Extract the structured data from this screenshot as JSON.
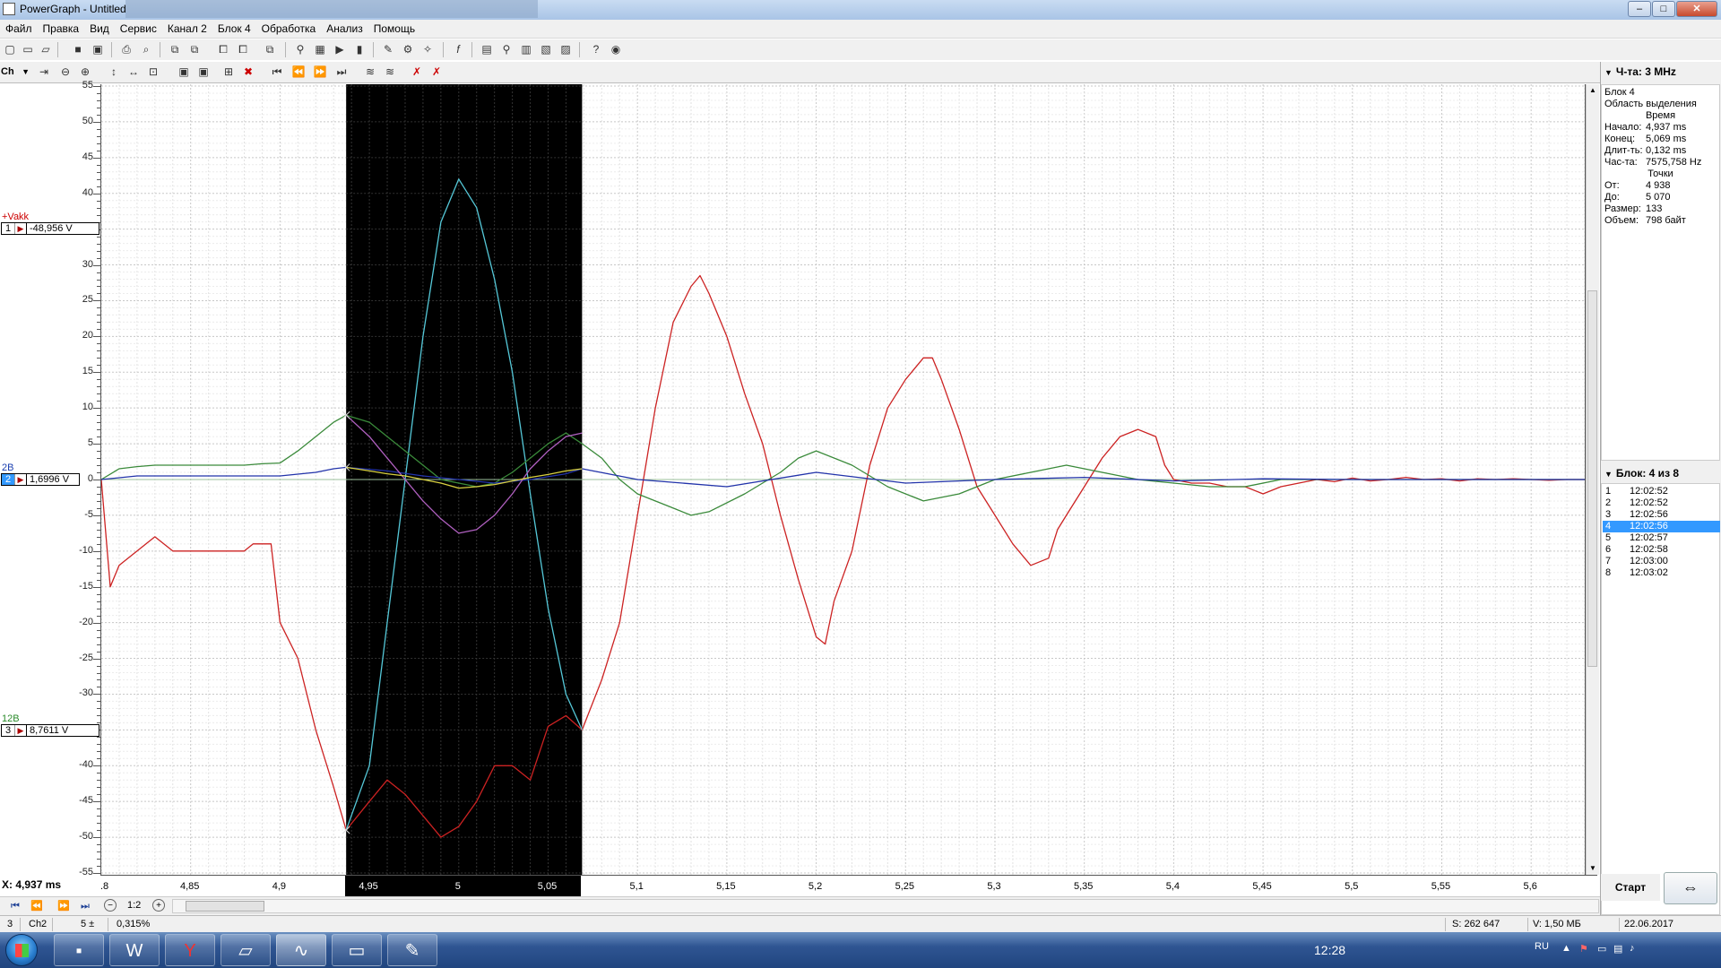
{
  "window": {
    "title": "PowerGraph - Untitled",
    "minimize": "–",
    "maximize": "□",
    "close": "✕"
  },
  "menu": [
    "Файл",
    "Правка",
    "Вид",
    "Сервис",
    "Канал 2",
    "Блок 4",
    "Обработка",
    "Анализ",
    "Помощь"
  ],
  "toolbar2": {
    "channel_select": "Ch"
  },
  "y_axis": {
    "ticks": [
      "55",
      "50",
      "45",
      "40",
      "35",
      "30",
      "25",
      "20",
      "15",
      "10",
      "5",
      "0",
      "-5",
      "-10",
      "-15",
      "-20",
      "-25",
      "-30",
      "-35",
      "-40",
      "-45",
      "-50",
      "-55"
    ]
  },
  "channels": [
    {
      "tag": "+Vakk",
      "num": "1",
      "value": "-48,956 V",
      "tag_color": "#cc0000",
      "selected": false
    },
    {
      "tag": "2B",
      "num": "2",
      "value": "1,6996 V",
      "tag_color": "#1a3fb0",
      "selected": true
    },
    {
      "tag": "12B",
      "num": "3",
      "value": "8,7611 V",
      "tag_color": "#2a8a2a",
      "selected": false
    }
  ],
  "x_axis": {
    "readout": "X: 4,937 ms",
    "ticks": [
      ".8",
      "4,85",
      "4,9",
      "4,95",
      "5",
      "5,05",
      "5,1",
      "5,15",
      "5,2",
      "5,25",
      "5,3",
      "5,35",
      "5,4",
      "5,45",
      "5,5",
      "5,55",
      "5,6"
    ]
  },
  "nav": {
    "zoom_label": "1:2",
    "first": "⏮",
    "prev": "⏪",
    "next": "⏩",
    "last": "⏭",
    "zoom_out": "−",
    "zoom_in": "+"
  },
  "status": {
    "num": "3",
    "channel": "Ch2",
    "value": "5 ±",
    "percent": "0,315%",
    "samples": "S: 262 647",
    "volume": "V: 1,50 МБ",
    "date": "22.06.2017"
  },
  "right_panel": {
    "freq": "Ч-та: 3 MHz",
    "block_title": "Блок 4",
    "selection_title": "Область выделения",
    "time_title": "Время",
    "time_rows": [
      {
        "k": "Начало:",
        "v": "4,937 ms"
      },
      {
        "k": "Конец:",
        "v": "5,069 ms"
      },
      {
        "k": "Длит-ть:",
        "v": "0,132 ms"
      },
      {
        "k": "Час-та:",
        "v": "7575,758 Hz"
      }
    ],
    "points_title": "Точки",
    "point_rows": [
      {
        "k": "От:",
        "v": "4 938"
      },
      {
        "k": "До:",
        "v": "5 070"
      },
      {
        "k": "Размер:",
        "v": "133"
      },
      {
        "k": "Объем:",
        "v": "798 байт"
      }
    ],
    "block_header": "Блок: 4 из 8",
    "blocks": [
      {
        "n": "1",
        "t": "12:02:52",
        "sel": false
      },
      {
        "n": "2",
        "t": "12:02:52",
        "sel": false
      },
      {
        "n": "3",
        "t": "12:02:56",
        "sel": false
      },
      {
        "n": "4",
        "t": "12:02:56",
        "sel": true
      },
      {
        "n": "5",
        "t": "12:02:57",
        "sel": false
      },
      {
        "n": "6",
        "t": "12:02:58",
        "sel": false
      },
      {
        "n": "7",
        "t": "12:03:00",
        "sel": false
      },
      {
        "n": "8",
        "t": "12:03:02",
        "sel": false
      }
    ],
    "start_label": "Старт"
  },
  "taskbar": {
    "lang": "RU",
    "time": "12:28"
  },
  "colors": {
    "red": "#cc2222",
    "cyan": "#55c8d8",
    "green": "#3a8a3a",
    "blue": "#2233aa",
    "magenta": "#b060c0",
    "yellow": "#d8d040",
    "selection": "#000000"
  },
  "chart_data": {
    "type": "line",
    "xlim": [
      4.8,
      5.63
    ],
    "ylim": [
      -55,
      55
    ],
    "selection": [
      4.937,
      5.069
    ],
    "series": [
      {
        "color": "#cc2222",
        "x": [
          4.8,
          4.805,
          4.81,
          4.815,
          4.82,
          4.83,
          4.84,
          4.845,
          4.85,
          4.86,
          4.87,
          4.88,
          4.885,
          4.89,
          4.895,
          4.9,
          4.91,
          4.92,
          4.93,
          4.937,
          4.95,
          4.96,
          4.97,
          4.98,
          4.99,
          5.0,
          5.01,
          5.02,
          5.03,
          5.04,
          5.05,
          5.06,
          5.069,
          5.08,
          5.09,
          5.1,
          5.11,
          5.12,
          5.13,
          5.135,
          5.14,
          5.15,
          5.16,
          5.17,
          5.18,
          5.19,
          5.2,
          5.205,
          5.21,
          5.22,
          5.23,
          5.24,
          5.25,
          5.26,
          5.265,
          5.27,
          5.28,
          5.29,
          5.3,
          5.31,
          5.32,
          5.33,
          5.335,
          5.34,
          5.35,
          5.36,
          5.37,
          5.38,
          5.39,
          5.395,
          5.4,
          5.41,
          5.42,
          5.43,
          5.44,
          5.45,
          5.455,
          5.46,
          5.47,
          5.48,
          5.49,
          5.5,
          5.51,
          5.52,
          5.53,
          5.54,
          5.55,
          5.56,
          5.57,
          5.58,
          5.59,
          5.6,
          5.61,
          5.62,
          5.63
        ],
        "y": [
          0,
          -15,
          -12,
          -11,
          -10,
          -8,
          -10,
          -10,
          -10,
          -10,
          -10,
          -10,
          -9,
          -9,
          -9,
          -20,
          -25,
          -35,
          -43,
          -49,
          -45,
          -42,
          -44,
          -47,
          -50,
          -48.5,
          -45,
          -40,
          -40,
          -42,
          -34.5,
          -33,
          -35,
          -28,
          -20,
          -5,
          10,
          22,
          27,
          28.5,
          26,
          20,
          12,
          5,
          -5,
          -14,
          -22,
          -23,
          -17,
          -10,
          2,
          10,
          14,
          17,
          17,
          14,
          7,
          -1,
          -5,
          -9,
          -12,
          -11,
          -7,
          -5,
          -1,
          3,
          6,
          7,
          6,
          2,
          0,
          -0.5,
          -0.5,
          -1,
          -1,
          -2,
          -1.5,
          -1,
          -0.5,
          0,
          -0.3,
          0.2,
          -0.2,
          0,
          0.3,
          0,
          0.1,
          -0.2,
          0.1,
          0,
          0.1,
          0,
          -0.1,
          0,
          0
        ]
      },
      {
        "color": "#55c8d8",
        "x": [
          4.937,
          4.95,
          4.96,
          4.97,
          4.98,
          4.99,
          5.0,
          5.01,
          5.02,
          5.03,
          5.04,
          5.05,
          5.06,
          5.069
        ],
        "y": [
          -49,
          -40,
          -20,
          0,
          20,
          36,
          42,
          38,
          28,
          15,
          -2,
          -18,
          -30,
          -35
        ]
      },
      {
        "color": "#3a8a3a",
        "x": [
          4.8,
          4.81,
          4.82,
          4.83,
          4.84,
          4.85,
          4.86,
          4.87,
          4.88,
          4.89,
          4.9,
          4.91,
          4.92,
          4.93,
          4.937,
          4.95,
          4.96,
          4.97,
          4.98,
          4.99,
          5.0,
          5.01,
          5.02,
          5.03,
          5.04,
          5.05,
          5.06,
          5.069,
          5.08,
          5.09,
          5.1,
          5.12,
          5.13,
          5.14,
          5.16,
          5.18,
          5.19,
          5.2,
          5.22,
          5.24,
          5.26,
          5.28,
          5.3,
          5.32,
          5.34,
          5.36,
          5.38,
          5.4,
          5.42,
          5.44,
          5.46,
          5.5,
          5.55,
          5.6,
          5.63
        ],
        "y": [
          0,
          1.5,
          1.8,
          2,
          2,
          2,
          2,
          2,
          2,
          2.2,
          2.3,
          4,
          6,
          8,
          9,
          8,
          6,
          4,
          2,
          0,
          -0.5,
          -1,
          -0.5,
          1,
          3,
          5,
          6.5,
          5,
          3,
          0,
          -2,
          -4,
          -5,
          -4.5,
          -2,
          1,
          3,
          4,
          2,
          -1,
          -3,
          -2,
          0,
          1,
          2,
          1,
          0,
          -0.5,
          -1,
          -1,
          0,
          0,
          0,
          0,
          0
        ]
      },
      {
        "color": "#2233aa",
        "x": [
          4.8,
          4.82,
          4.84,
          4.86,
          4.88,
          4.9,
          4.92,
          4.93,
          4.937,
          4.96,
          4.98,
          5.0,
          5.02,
          5.04,
          5.06,
          5.069,
          5.1,
          5.15,
          5.2,
          5.25,
          5.3,
          5.35,
          5.4,
          5.45,
          5.5,
          5.55,
          5.6,
          5.63
        ],
        "y": [
          0,
          0.5,
          0.5,
          0.5,
          0.5,
          0.5,
          1,
          1.5,
          1.7,
          1.2,
          0.5,
          0,
          -0.5,
          0,
          0.8,
          1.5,
          0,
          -1,
          1,
          -0.5,
          0,
          0.3,
          -0.2,
          0.1,
          0,
          0,
          0,
          0
        ]
      },
      {
        "color": "#b060c0",
        "x": [
          4.937,
          4.95,
          4.96,
          4.97,
          4.98,
          4.99,
          5.0,
          5.01,
          5.02,
          5.03,
          5.04,
          5.05,
          5.06,
          5.069
        ],
        "y": [
          9,
          6,
          3,
          0,
          -3,
          -5.5,
          -7.5,
          -7,
          -5,
          -2,
          1.5,
          4,
          6,
          6.5
        ]
      },
      {
        "color": "#d8d040",
        "x": [
          4.937,
          4.95,
          4.96,
          4.97,
          4.98,
          4.99,
          5.0,
          5.01,
          5.02,
          5.03,
          5.04,
          5.05,
          5.06,
          5.069
        ],
        "y": [
          1.7,
          1.2,
          0.8,
          0.5,
          0,
          -0.5,
          -1.2,
          -1,
          -0.7,
          -0.2,
          0.3,
          0.7,
          1.2,
          1.5
        ]
      }
    ]
  }
}
